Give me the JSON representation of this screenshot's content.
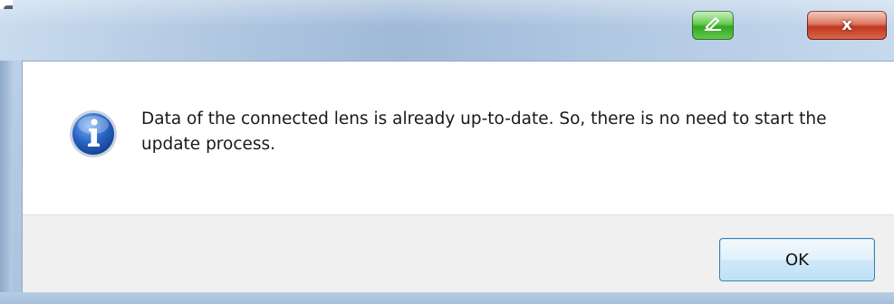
{
  "dialog": {
    "title": "",
    "message": "Data of the connected lens is already up-to-date. So, there is no need to start the update process.",
    "ok_label": "OK",
    "close_glyph": "x",
    "icons": {
      "message_icon": "information-icon",
      "titlebar_green": "pen-icon",
      "close": "close-icon"
    }
  },
  "colors": {
    "info_icon_blue": "#1e56b7",
    "close_red": "#c0391f",
    "extra_button_green": "#35a523"
  }
}
